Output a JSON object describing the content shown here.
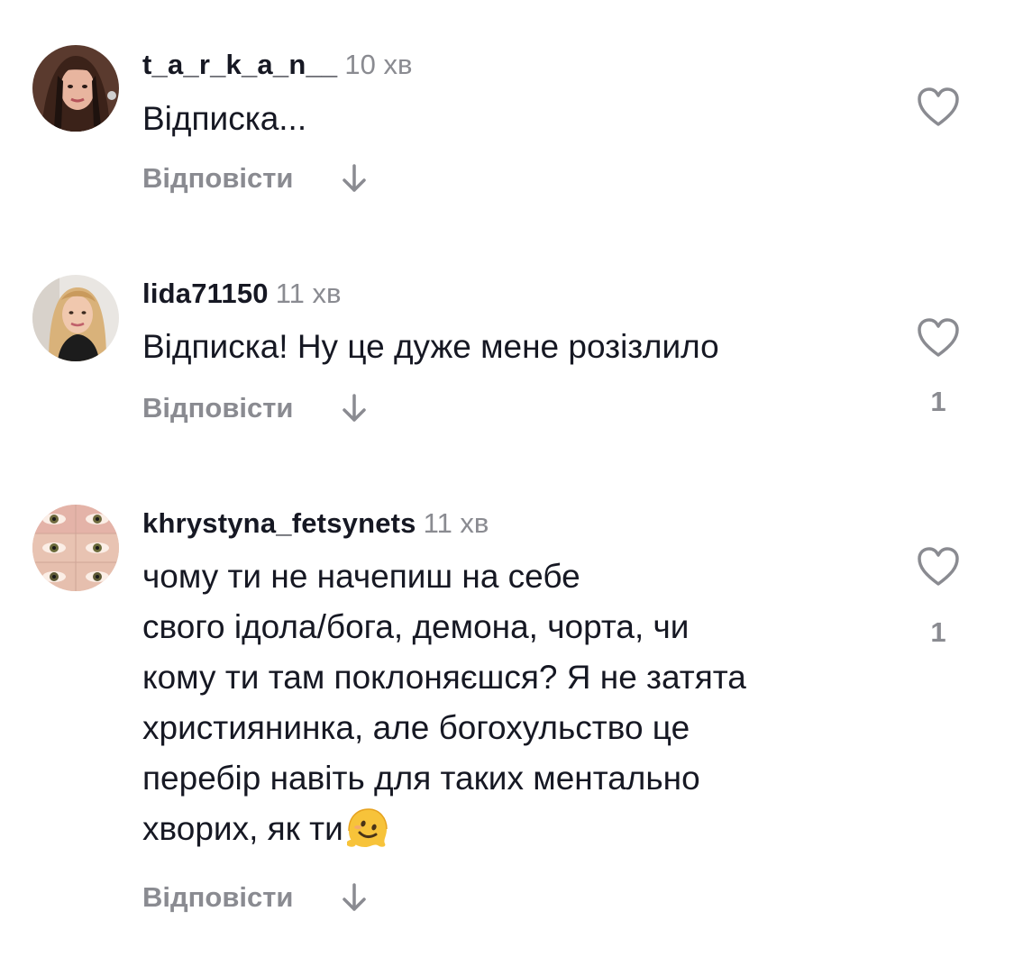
{
  "comments": [
    {
      "username": "t_a_r_k_a_n__",
      "time": "10 хв",
      "lines": [
        "Відписка..."
      ],
      "reply_label": "Відповісти",
      "likes": "",
      "avatar_icon": "avatar-photo-woman-dark-hair"
    },
    {
      "username": "lida71150",
      "time": "11 хв",
      "lines": [
        "Відписка! Ну це дуже мене розізлило"
      ],
      "reply_label": "Відповісти",
      "likes": "1",
      "avatar_icon": "avatar-photo-woman-blonde"
    },
    {
      "username": "khrystyna_fetsynets",
      "time": "11 хв",
      "lines": [
        "чому ти не начепиш на себе",
        "свого ідола/бога, демона, чорта, чи",
        "кому ти там поклоняєшся? Я не затята",
        "християнинка, але богохульство це",
        "перебір навіть для таких ментально",
        "хворих, як ти"
      ],
      "emoji": "melting-face-emoji",
      "reply_label": "Відповісти",
      "likes": "1",
      "avatar_icon": "avatar-photo-eyes-collage"
    }
  ],
  "icons": {
    "like": "heart-outline-icon",
    "expand": "arrow-down-icon"
  },
  "colors": {
    "text": "#161823",
    "secondary": "#8a8b91",
    "background": "#ffffff"
  }
}
